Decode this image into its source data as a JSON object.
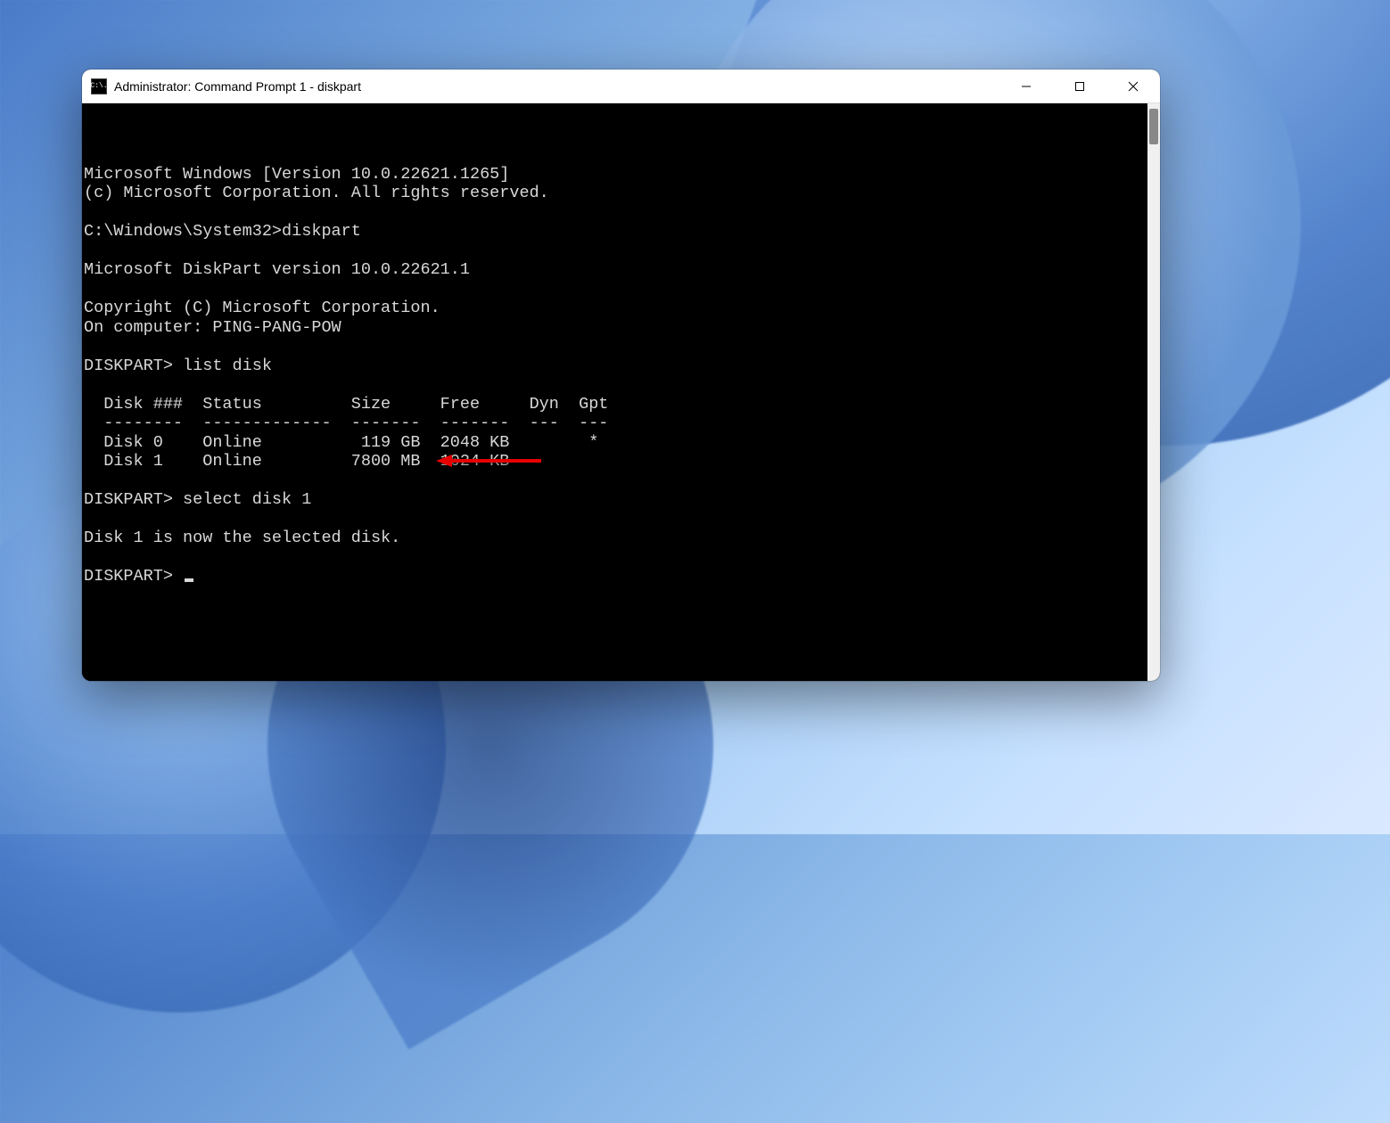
{
  "window": {
    "title": "Administrator: Command Prompt 1 - diskpart",
    "icon_label": "C:\\."
  },
  "terminal": {
    "lines": {
      "l01": "Microsoft Windows [Version 10.0.22621.1265]",
      "l02": "(c) Microsoft Corporation. All rights reserved.",
      "l03": "",
      "l04": "C:\\Windows\\System32>diskpart",
      "l05": "",
      "l06": "Microsoft DiskPart version 10.0.22621.1",
      "l07": "",
      "l08": "Copyright (C) Microsoft Corporation.",
      "l09": "On computer: PING-PANG-POW",
      "l10": "",
      "l11": "DISKPART> list disk",
      "l12": "",
      "l13": "  Disk ###  Status         Size     Free     Dyn  Gpt",
      "l14": "  --------  -------------  -------  -------  ---  ---",
      "l15": "  Disk 0    Online          119 GB  2048 KB        *",
      "l16": "  Disk 1    Online         7800 MB  1024 KB",
      "l17": "",
      "l18": "DISKPART> select disk 1",
      "l19": "",
      "l20": "Disk 1 is now the selected disk.",
      "l21": "",
      "l22": "DISKPART> "
    }
  },
  "diskpart": {
    "version": "10.0.22621.1",
    "computer": "PING-PANG-POW",
    "disks": [
      {
        "id": "Disk 0",
        "status": "Online",
        "size": "119 GB",
        "free": "2048 KB",
        "dyn": "",
        "gpt": "*"
      },
      {
        "id": "Disk 1",
        "status": "Online",
        "size": "7800 MB",
        "free": "1024 KB",
        "dyn": "",
        "gpt": ""
      }
    ],
    "last_command": "select disk 1",
    "result": "Disk 1 is now the selected disk."
  },
  "annotation": {
    "type": "arrow",
    "color": "#e60000",
    "points_at": "select disk 1"
  }
}
